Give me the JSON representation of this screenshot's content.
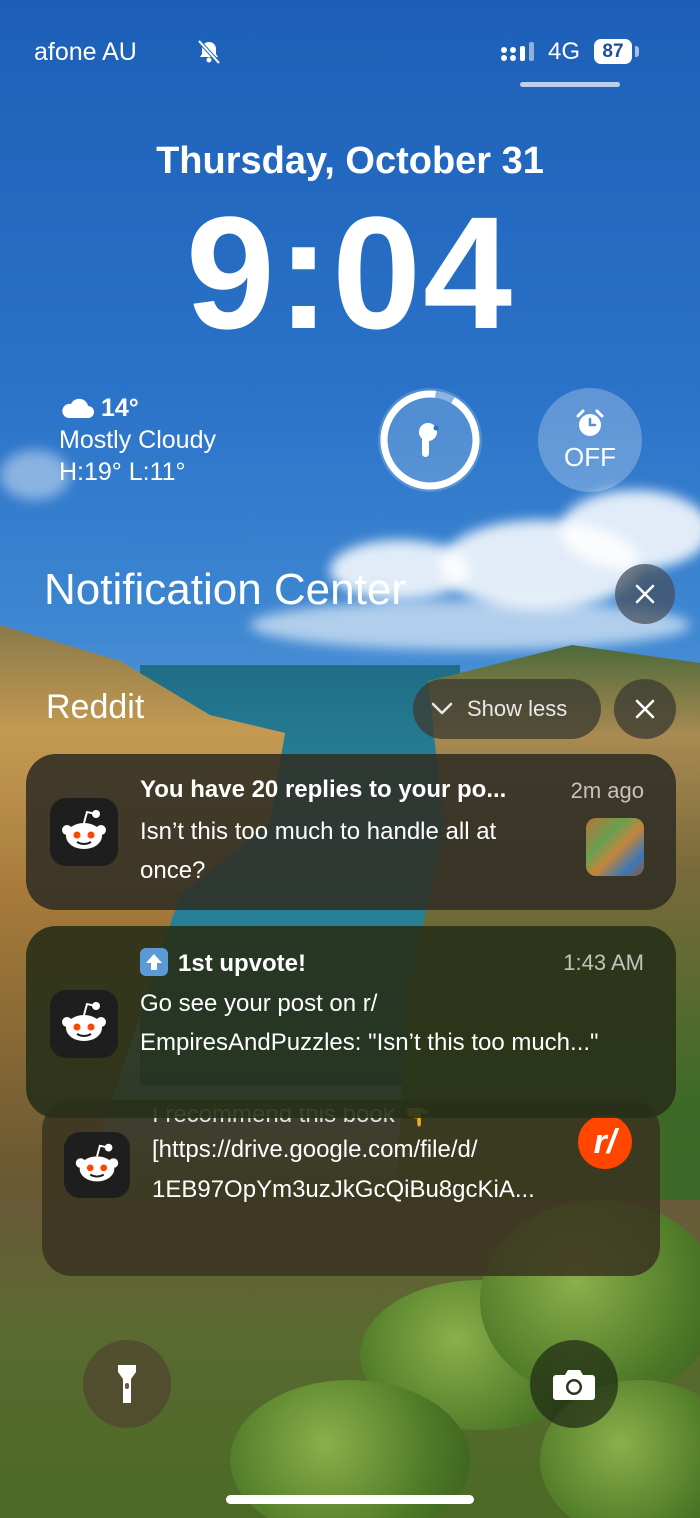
{
  "status_bar": {
    "carrier": "afone AU",
    "network": "4G",
    "battery": "87",
    "icons": [
      "mute-bell-icon",
      "signal-icon",
      "battery-icon"
    ]
  },
  "lock_screen": {
    "date": "Thursday, October 31",
    "time": "9:04"
  },
  "widgets": {
    "weather": {
      "icon": "cloud-icon",
      "temperature": "14°",
      "condition": "Mostly Cloudy",
      "high_low": "H:19° L:11°"
    },
    "airpods": {
      "icon": "airpods-icon"
    },
    "alarm": {
      "icon": "alarm-clock-icon",
      "state": "OFF"
    }
  },
  "notification_center": {
    "title": "Notification Center",
    "group": {
      "app_name": "Reddit",
      "show_less_label": "Show less",
      "notifications": [
        {
          "title": "You have 20 replies to your po...",
          "time": "2m ago",
          "body": "Isn’t this too much to handle all at once?"
        },
        {
          "emoji": "up-arrow-icon",
          "title": "1st upvote!",
          "time": "1:43 AM",
          "body": "Go see your post on r/ EmpiresAndPuzzles: \"Isn’t this too much...\""
        },
        {
          "partial_line": "I recommend this book 👇",
          "body": "[https://drive.google.com/file/d/ 1EB97OpYm3uzJkGcQiBu8gcKiA...",
          "badge": "r/"
        }
      ]
    }
  },
  "controls": {
    "flashlight": "flashlight-icon",
    "camera": "camera-icon"
  },
  "colors": {
    "reddit_orange": "#ff4500",
    "sky_blue": "#2a72c8"
  }
}
